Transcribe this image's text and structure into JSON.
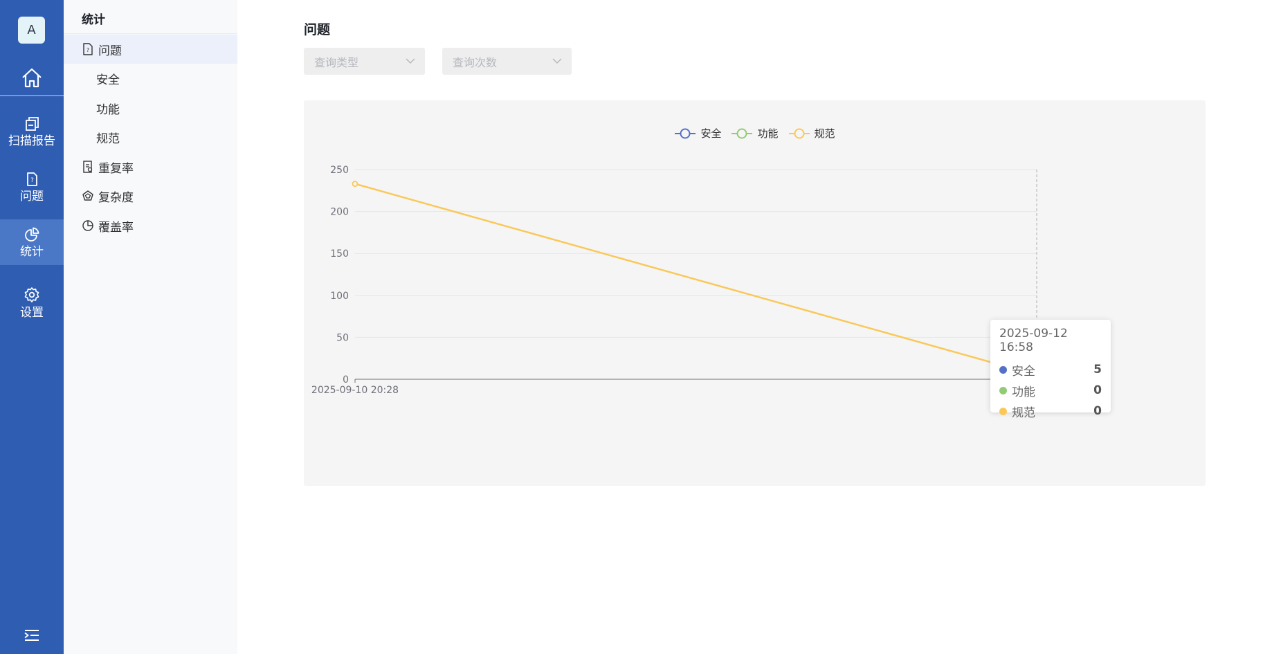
{
  "rail": {
    "avatar": "A",
    "items": [
      {
        "label": "扫描报告",
        "icon": "report-icon"
      },
      {
        "label": "问题",
        "icon": "issue-doc-icon"
      },
      {
        "label": "统计",
        "icon": "pie-chart-icon"
      },
      {
        "label": "设置",
        "icon": "gear-icon"
      }
    ],
    "active": "统计"
  },
  "submenu": {
    "title": "统计",
    "items": [
      {
        "label": "问题",
        "icon": "issue-doc-icon",
        "active": true
      },
      {
        "label": "安全",
        "child": true
      },
      {
        "label": "功能",
        "child": true
      },
      {
        "label": "规范",
        "child": true
      },
      {
        "label": "重复率",
        "icon": "duplicate-icon"
      },
      {
        "label": "复杂度",
        "icon": "complexity-icon"
      },
      {
        "label": "覆盖率",
        "icon": "coverage-icon"
      }
    ]
  },
  "main": {
    "title": "问题",
    "filters": {
      "type_placeholder": "查询类型",
      "count_placeholder": "查询次数"
    }
  },
  "chart_data": {
    "type": "line",
    "x": [
      "2025-09-10 20:28",
      "2025-09-12 16:58"
    ],
    "x_tick_labels": [
      "2025-09-10 20:28",
      "2025-09-12 16:5"
    ],
    "series": [
      {
        "name": "安全",
        "color": "#5470c6",
        "values": [
          null,
          5
        ]
      },
      {
        "name": "功能",
        "color": "#91cc75",
        "values": [
          null,
          0
        ]
      },
      {
        "name": "规范",
        "color": "#fac858",
        "values": [
          233,
          5
        ]
      }
    ],
    "ylim": [
      0,
      250
    ],
    "yticks": [
      0,
      50,
      100,
      150,
      200,
      250
    ],
    "grid": true,
    "legend": "top-center",
    "tooltip": {
      "title": "2025-09-12 16:58",
      "rows": [
        {
          "name": "安全",
          "value": "5",
          "color": "#5470c6"
        },
        {
          "name": "功能",
          "value": "0",
          "color": "#91cc75"
        },
        {
          "name": "规范",
          "value": "0",
          "color": "#fac858"
        }
      ]
    }
  }
}
